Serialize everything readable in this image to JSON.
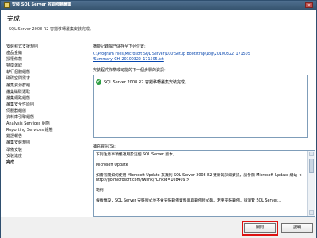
{
  "window": {
    "title": "安裝 SQL Server 容錯移轉叢集",
    "close_glyph": "×"
  },
  "header": {
    "title": "完成",
    "subtitle": "SQL Server 2008 R2 容錯移轉叢集安裝完成。"
  },
  "sidebar": {
    "items": [
      {
        "label": "安裝程式支援規則",
        "active": false
      },
      {
        "label": "產品金鑰",
        "active": false
      },
      {
        "label": "授權條款",
        "active": false
      },
      {
        "label": "特徵選取",
        "active": false
      },
      {
        "label": "執行個體組態",
        "active": false
      },
      {
        "label": "磁碟空間需求",
        "active": false
      },
      {
        "label": "叢集資源群組",
        "active": false
      },
      {
        "label": "叢集磁碟選取",
        "active": false
      },
      {
        "label": "叢集網路組態",
        "active": false
      },
      {
        "label": "叢集安全性原則",
        "active": false
      },
      {
        "label": "伺服器組態",
        "active": false
      },
      {
        "label": "資料庫引擎組態",
        "active": false
      },
      {
        "label": "Analysis Services 組態",
        "active": false
      },
      {
        "label": "Reporting Services 組態",
        "active": false
      },
      {
        "label": "錯誤報告",
        "active": false
      },
      {
        "label": "叢集安裝規則",
        "active": false
      },
      {
        "label": "準備安裝",
        "active": false
      },
      {
        "label": "安裝進度",
        "active": false
      },
      {
        "label": "完成",
        "active": true
      }
    ]
  },
  "main": {
    "log_label": "摘要記錄檔已儲存至下列位置:",
    "log_link_1": "C:\\Program Files\\Microsoft SQL Server\\100\\Setup Bootstrap\\Log\\20100322_171505",
    "log_link_2": "\\Summary_CH_20100322_171505.txt",
    "status_label": "安裝程式作業或可能的下一個步驟的資訊:",
    "status_message": "SQL Server 2008 R2 容錯移轉叢集安裝完成。",
    "supplemental_label": "補充資訊(S):",
    "supplemental_paragraphs": [
      "下列注意事項僅適用於這個 SQL Server 版本。",
      "Microsoft Update",
      "如需有關如何使用 Microsoft Update 來識別 SQL Server 2008 R2 更新的詳細資訊，請參閱 Microsoft Update 網站 < http://go.microsoft.com/fwlink/?LinkId=108409 >",
      "範例",
      "根據預設，SQL Server 安裝程式並不會安裝範例資料庫與範例程式碼。若要安裝範例，請瀏覽 SQL Server..."
    ]
  },
  "footer": {
    "close_label": "關閉",
    "help_label": "說明"
  }
}
